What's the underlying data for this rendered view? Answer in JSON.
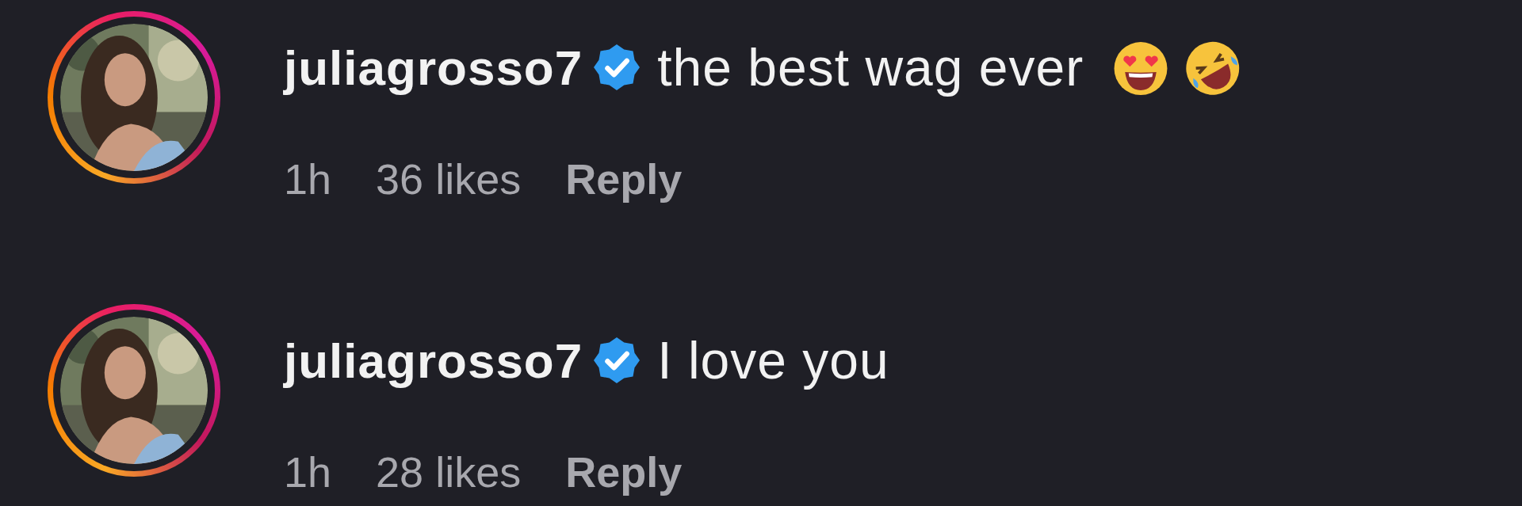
{
  "comments": [
    {
      "avatar": {
        "kind": "picture",
        "story_ring": true
      },
      "username": "juliagrosso7",
      "verified": true,
      "text": "the best wag ever",
      "emojis": [
        {
          "kind": "heart-eyes"
        },
        {
          "kind": "rolling-laughing"
        }
      ],
      "time": "1h",
      "likes": "36 likes",
      "reply": "Reply"
    },
    {
      "avatar": {
        "kind": "picture",
        "story_ring": true
      },
      "username": "juliagrosso7",
      "verified": true,
      "text": "I love you",
      "time": "1h",
      "likes": "28 likes",
      "reply": "Reply"
    }
  ]
}
